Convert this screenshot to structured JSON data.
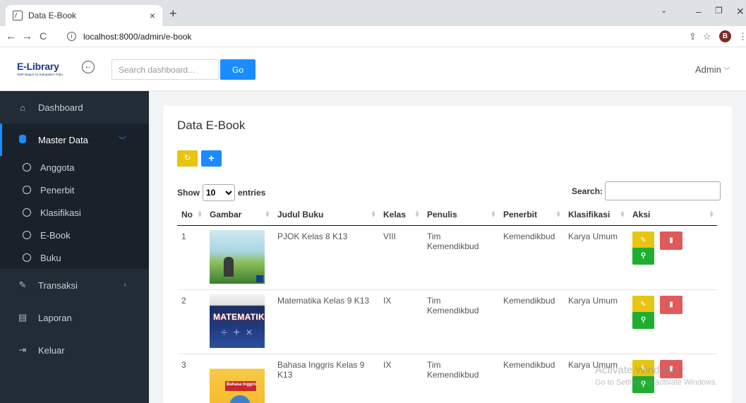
{
  "browser": {
    "tab_title": "Data E-Book",
    "tab_close": "×",
    "new_tab": "+",
    "url": "localhost:8000/admin/e-book",
    "profile_initial": "B"
  },
  "header": {
    "logo": "E-Library",
    "logo_sub": "SMP Negeri 01 Kabupaten Tuba",
    "search_placeholder": "Search dashboard...",
    "go_label": "Go",
    "user": "Admin"
  },
  "sidebar": {
    "items": [
      {
        "label": "Dashboard",
        "icon": "home-icon"
      },
      {
        "label": "Master Data",
        "icon": "database-icon"
      },
      {
        "label": "Transaksi",
        "icon": "pencil-icon"
      },
      {
        "label": "Laporan",
        "icon": "report-icon"
      },
      {
        "label": "Keluar",
        "icon": "logout-icon"
      }
    ],
    "sub_items": [
      "Anggota",
      "Penerbit",
      "Klasifikasi",
      "E-Book",
      "Buku"
    ]
  },
  "main": {
    "title": "Data E-Book",
    "show_label": "Show",
    "entries_value": "10",
    "entries_label": "entries",
    "search_label": "Search:",
    "columns": [
      "No",
      "Gambar",
      "Judul Buku",
      "Kelas",
      "Penulis",
      "Penerbit",
      "Klasifikasi",
      "Aksi"
    ],
    "rows": [
      {
        "no": "1",
        "judul": "PJOK Kelas 8 K13",
        "kelas": "VIII",
        "penulis": "Tim Kemendikbud",
        "penerbit": "Kemendikbud",
        "klasifikasi": "Karya Umum"
      },
      {
        "no": "2",
        "judul": "Matematika Kelas 9 K13",
        "kelas": "IX",
        "penulis": "Tim Kemendikbud",
        "penerbit": "Kemendikbud",
        "klasifikasi": "Karya Umum",
        "cover_text": "MATEMATIKA"
      },
      {
        "no": "3",
        "judul": "Bahasa Inggris Kelas 9 K13",
        "kelas": "IX",
        "penulis": "Tim Kemendikbud",
        "penerbit": "Kemendikbud",
        "klasifikasi": "Karya Umum",
        "cover_text": "Bahasa Inggris"
      }
    ]
  },
  "watermark": {
    "line1": "Activate Windows",
    "line2": "Go to Settings to activate Windows."
  }
}
